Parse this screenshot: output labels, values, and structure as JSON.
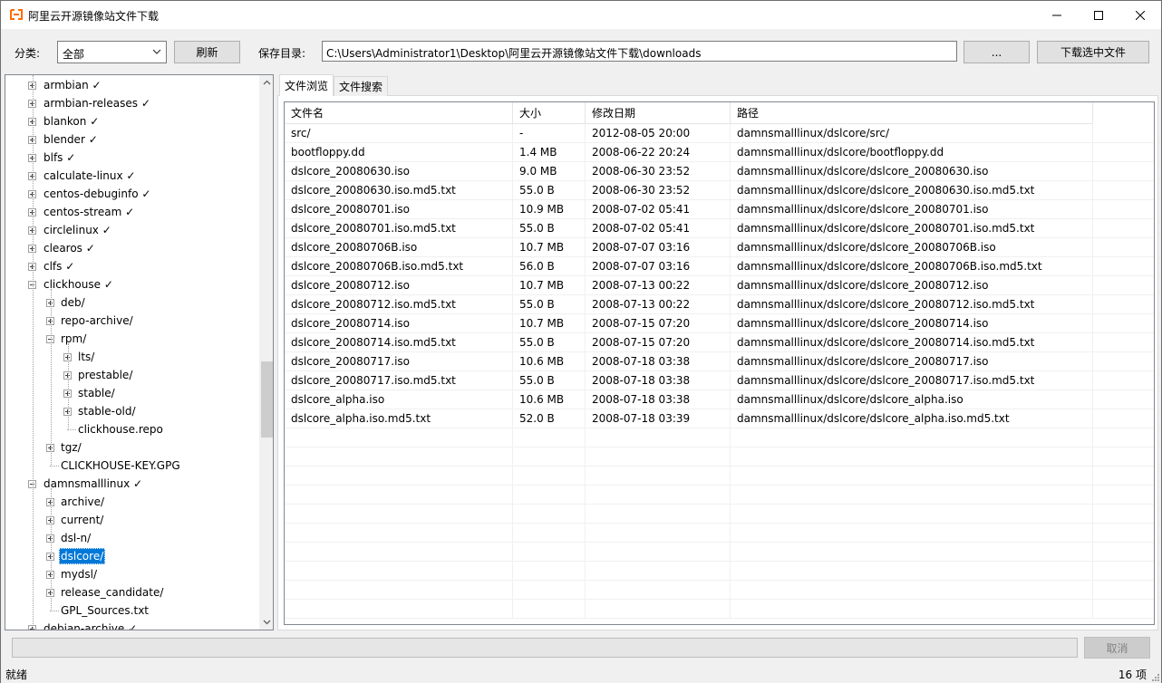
{
  "window": {
    "title": "阿里云开源镜像站文件下载",
    "accent": "#0078d7"
  },
  "toolbar": {
    "category_label": "分类:",
    "category_value": "全部",
    "refresh_label": "刷新",
    "save_dir_label": "保存目录:",
    "save_dir_value": "C:\\Users\\Administrator1\\Desktop\\阿里云开源镜像站文件下载\\downloads",
    "browse_label": "...",
    "download_label": "下载选中文件"
  },
  "tree": {
    "items": [
      {
        "label": "armbian ✓",
        "level": 0,
        "expander": "plus"
      },
      {
        "label": "armbian-releases ✓",
        "level": 0,
        "expander": "plus"
      },
      {
        "label": "blankon ✓",
        "level": 0,
        "expander": "plus"
      },
      {
        "label": "blender ✓",
        "level": 0,
        "expander": "plus"
      },
      {
        "label": "blfs ✓",
        "level": 0,
        "expander": "plus"
      },
      {
        "label": "calculate-linux ✓",
        "level": 0,
        "expander": "plus"
      },
      {
        "label": "centos-debuginfo ✓",
        "level": 0,
        "expander": "plus"
      },
      {
        "label": "centos-stream ✓",
        "level": 0,
        "expander": "plus"
      },
      {
        "label": "circlelinux ✓",
        "level": 0,
        "expander": "plus"
      },
      {
        "label": "clearos ✓",
        "level": 0,
        "expander": "plus"
      },
      {
        "label": "clfs ✓",
        "level": 0,
        "expander": "plus"
      },
      {
        "label": "clickhouse ✓",
        "level": 0,
        "expander": "minus"
      },
      {
        "label": "deb/",
        "level": 1,
        "expander": "plus"
      },
      {
        "label": "repo-archive/",
        "level": 1,
        "expander": "plus"
      },
      {
        "label": "rpm/",
        "level": 1,
        "expander": "minus"
      },
      {
        "label": "lts/",
        "level": 2,
        "expander": "plus"
      },
      {
        "label": "prestable/",
        "level": 2,
        "expander": "plus"
      },
      {
        "label": "stable/",
        "level": 2,
        "expander": "plus"
      },
      {
        "label": "stable-old/",
        "level": 2,
        "expander": "plus"
      },
      {
        "label": "clickhouse.repo",
        "level": 2,
        "expander": "none"
      },
      {
        "label": "tgz/",
        "level": 1,
        "expander": "plus"
      },
      {
        "label": "CLICKHOUSE-KEY.GPG",
        "level": 1,
        "expander": "none"
      },
      {
        "label": "damnsmalllinux ✓",
        "level": 0,
        "expander": "minus"
      },
      {
        "label": "archive/",
        "level": 1,
        "expander": "plus"
      },
      {
        "label": "current/",
        "level": 1,
        "expander": "plus"
      },
      {
        "label": "dsl-n/",
        "level": 1,
        "expander": "plus"
      },
      {
        "label": "dslcore/",
        "level": 1,
        "expander": "plus",
        "selected": true
      },
      {
        "label": "mydsl/",
        "level": 1,
        "expander": "plus"
      },
      {
        "label": "release_candidate/",
        "level": 1,
        "expander": "plus"
      },
      {
        "label": "GPL_Sources.txt",
        "level": 1,
        "expander": "none"
      },
      {
        "label": "debian-archive ✓",
        "level": 0,
        "expander": "plus"
      }
    ]
  },
  "tabs": [
    {
      "label": "文件浏览",
      "active": true
    },
    {
      "label": "文件搜索",
      "active": false
    }
  ],
  "grid": {
    "columns": [
      "文件名",
      "大小",
      "修改日期",
      "路径"
    ],
    "rows": [
      [
        "src/",
        "-",
        "2012-08-05 20:00",
        "damnsmalllinux/dslcore/src/"
      ],
      [
        "bootfloppy.dd",
        "1.4 MB",
        "2008-06-22 20:24",
        "damnsmalllinux/dslcore/bootfloppy.dd"
      ],
      [
        "dslcore_20080630.iso",
        "9.0 MB",
        "2008-06-30 23:52",
        "damnsmalllinux/dslcore/dslcore_20080630.iso"
      ],
      [
        "dslcore_20080630.iso.md5.txt",
        "55.0 B",
        "2008-06-30 23:52",
        "damnsmalllinux/dslcore/dslcore_20080630.iso.md5.txt"
      ],
      [
        "dslcore_20080701.iso",
        "10.9 MB",
        "2008-07-02 05:41",
        "damnsmalllinux/dslcore/dslcore_20080701.iso"
      ],
      [
        "dslcore_20080701.iso.md5.txt",
        "55.0 B",
        "2008-07-02 05:41",
        "damnsmalllinux/dslcore/dslcore_20080701.iso.md5.txt"
      ],
      [
        "dslcore_20080706B.iso",
        "10.7 MB",
        "2008-07-07 03:16",
        "damnsmalllinux/dslcore/dslcore_20080706B.iso"
      ],
      [
        "dslcore_20080706B.iso.md5.txt",
        "56.0 B",
        "2008-07-07 03:16",
        "damnsmalllinux/dslcore/dslcore_20080706B.iso.md5.txt"
      ],
      [
        "dslcore_20080712.iso",
        "10.7 MB",
        "2008-07-13 00:22",
        "damnsmalllinux/dslcore/dslcore_20080712.iso"
      ],
      [
        "dslcore_20080712.iso.md5.txt",
        "55.0 B",
        "2008-07-13 00:22",
        "damnsmalllinux/dslcore/dslcore_20080712.iso.md5.txt"
      ],
      [
        "dslcore_20080714.iso",
        "10.7 MB",
        "2008-07-15 07:20",
        "damnsmalllinux/dslcore/dslcore_20080714.iso"
      ],
      [
        "dslcore_20080714.iso.md5.txt",
        "55.0 B",
        "2008-07-15 07:20",
        "damnsmalllinux/dslcore/dslcore_20080714.iso.md5.txt"
      ],
      [
        "dslcore_20080717.iso",
        "10.6 MB",
        "2008-07-18 03:38",
        "damnsmalllinux/dslcore/dslcore_20080717.iso"
      ],
      [
        "dslcore_20080717.iso.md5.txt",
        "55.0 B",
        "2008-07-18 03:38",
        "damnsmalllinux/dslcore/dslcore_20080717.iso.md5.txt"
      ],
      [
        "dslcore_alpha.iso",
        "10.6 MB",
        "2008-07-18 03:38",
        "damnsmalllinux/dslcore/dslcore_alpha.iso"
      ],
      [
        "dslcore_alpha.iso.md5.txt",
        "52.0 B",
        "2008-07-18 03:39",
        "damnsmalllinux/dslcore/dslcore_alpha.iso.md5.txt"
      ]
    ]
  },
  "progress": {
    "fraction": 0
  },
  "cancel_label": "取消",
  "status": {
    "left": "就绪",
    "right": "16 项"
  }
}
